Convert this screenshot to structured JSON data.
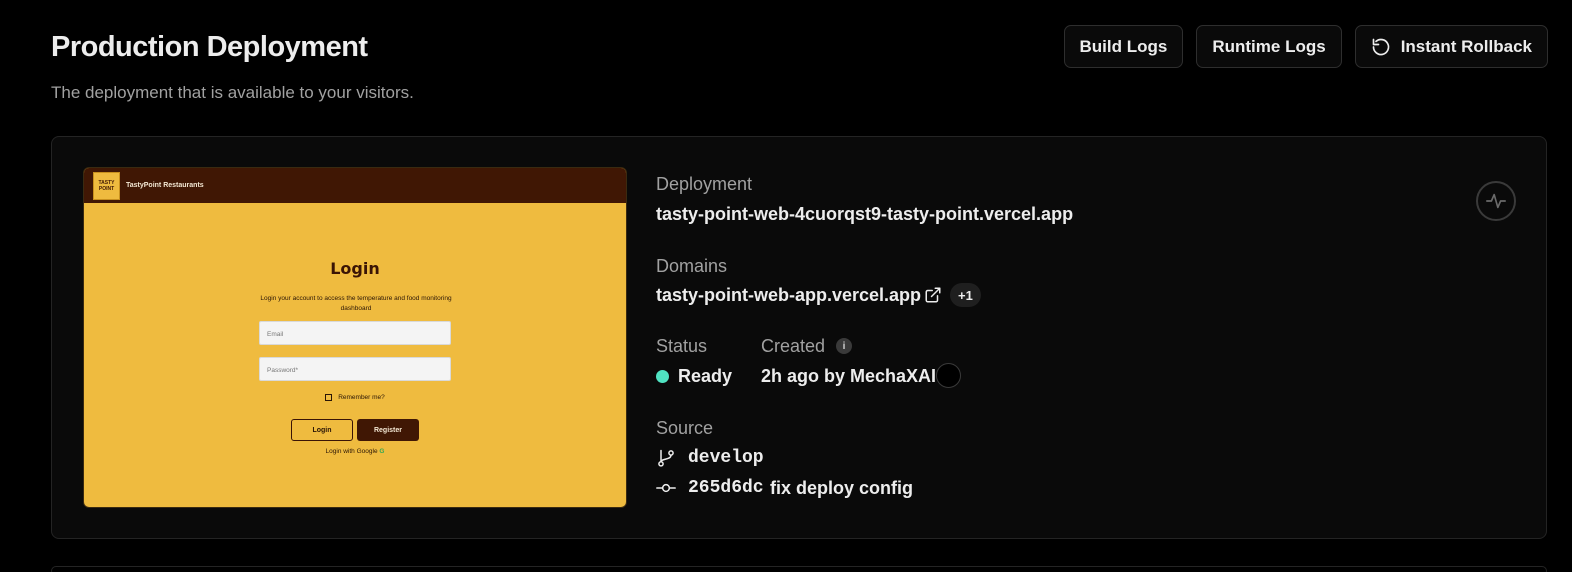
{
  "header": {
    "title": "Production Deployment",
    "subtitle": "The deployment that is available to your visitors."
  },
  "actions": {
    "build_logs": "Build Logs",
    "runtime_logs": "Runtime Logs",
    "instant_rollback": "Instant Rollback"
  },
  "preview": {
    "brand": "TastyPoint Restaurants",
    "logo_text": "TASTY POINT",
    "login_title": "Login",
    "description": "Login your account to access the temperature and food monitoring dashboard",
    "email_placeholder": "Email",
    "password_placeholder": "Password*",
    "remember_me": "Remember me?",
    "login_button": "Login",
    "register_button": "Register",
    "google_login": "Login with Google"
  },
  "deployment": {
    "label": "Deployment",
    "url": "tasty-point-web-4cuorqst9-tasty-point.vercel.app"
  },
  "domains": {
    "label": "Domains",
    "primary": "tasty-point-web-app.vercel.app",
    "extra_count": "+1"
  },
  "status": {
    "label": "Status",
    "value": "Ready",
    "color": "#50e3c2"
  },
  "created": {
    "label": "Created",
    "value": "2h ago by MechaXAI"
  },
  "source": {
    "label": "Source",
    "branch": "develop",
    "commit_hash": "265d6dc",
    "commit_message": "fix deploy config"
  },
  "icons": {
    "rollback": "rollback-icon",
    "external_link": "external-link-icon",
    "info": "info-icon",
    "branch": "git-branch-icon",
    "commit": "git-commit-icon",
    "activity": "activity-icon"
  }
}
